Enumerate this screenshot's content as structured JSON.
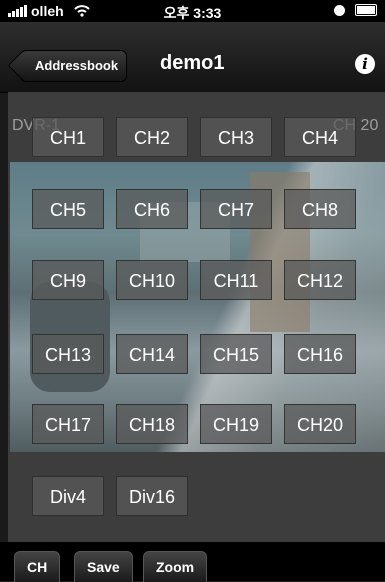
{
  "status_bar": {
    "carrier": "olleh",
    "time": "오후 3:33"
  },
  "nav": {
    "back_label": "Addressbook",
    "title": "demo1",
    "info_icon": "i"
  },
  "overlay": {
    "dvr_left": "DVR-1",
    "dvr_right": "CH 20"
  },
  "channels": [
    "CH1",
    "CH2",
    "CH3",
    "CH4",
    "CH5",
    "CH6",
    "CH7",
    "CH8",
    "CH9",
    "CH10",
    "CH11",
    "CH12",
    "CH13",
    "CH14",
    "CH15",
    "CH16",
    "CH17",
    "CH18",
    "CH19",
    "CH20"
  ],
  "divisions": [
    "Div4",
    "Div16"
  ],
  "toolbar": {
    "ch_label": "CH",
    "save_label": "Save",
    "zoom_label": "Zoom"
  }
}
